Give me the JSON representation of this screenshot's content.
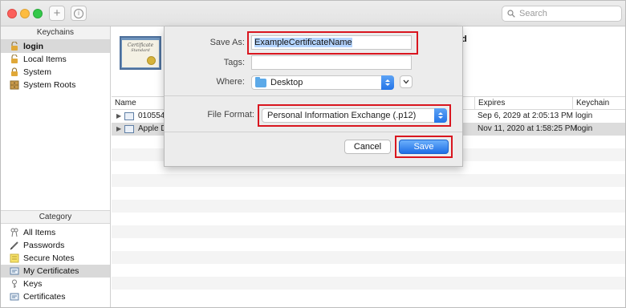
{
  "toolbar": {
    "add_icon": "+",
    "info_icon": "i",
    "search_placeholder": "Search"
  },
  "sidebar": {
    "keychains_header": "Keychains",
    "keychains": [
      {
        "label": "login",
        "icon": "lock-open-icon",
        "selected": true
      },
      {
        "label": "Local Items",
        "icon": "lock-open-icon",
        "selected": false
      },
      {
        "label": "System",
        "icon": "lock-icon",
        "selected": false
      },
      {
        "label": "System Roots",
        "icon": "cabinet-icon",
        "selected": false
      }
    ],
    "category_header": "Category",
    "categories": [
      {
        "label": "All Items",
        "icon": "keys-icon",
        "selected": false
      },
      {
        "label": "Passwords",
        "icon": "pen-icon",
        "selected": false
      },
      {
        "label": "Secure Notes",
        "icon": "note-icon",
        "selected": false
      },
      {
        "label": "My Certificates",
        "icon": "certificate-icon",
        "selected": true
      },
      {
        "label": "Keys",
        "icon": "key-icon",
        "selected": false
      },
      {
        "label": "Certificates",
        "icon": "certificate-icon",
        "selected": false
      }
    ]
  },
  "certificate_preview": {
    "image_text_1": "Certificate",
    "image_text_2": "Standard",
    "trailing_text": "d"
  },
  "table": {
    "columns": [
      "Name",
      "Expires",
      "Keychain"
    ],
    "rows": [
      {
        "name": "010554",
        "expires": "Sep 6, 2029 at 2:05:13 PM",
        "keychain": "login",
        "selected": false
      },
      {
        "name": "Apple D",
        "expires": "Nov 11, 2020 at 1:58:25 PM",
        "keychain": "login",
        "selected": true
      }
    ]
  },
  "save_sheet": {
    "save_as_label": "Save As:",
    "save_as_value": "ExampleCertificateName",
    "tags_label": "Tags:",
    "tags_value": "",
    "where_label": "Where:",
    "where_value": "Desktop",
    "file_format_label": "File Format:",
    "file_format_value": "Personal Information Exchange (.p12)",
    "cancel_label": "Cancel",
    "save_label": "Save",
    "highlight_color": "#d9161f",
    "accent_color": "#2374e8"
  }
}
